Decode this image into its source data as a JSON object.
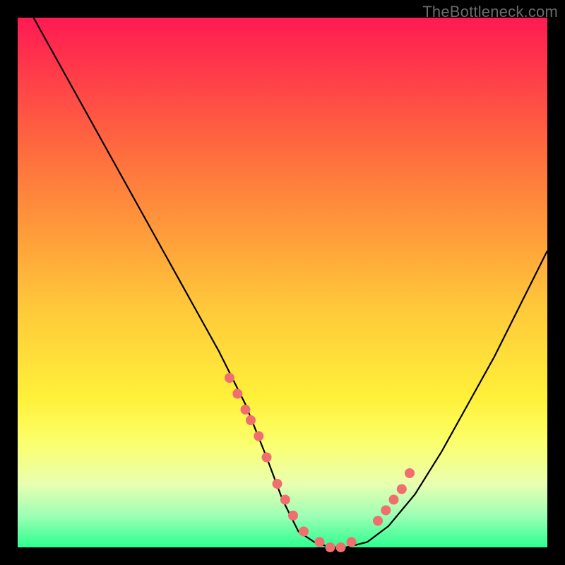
{
  "watermark": "TheBottleneck.com",
  "chart_data": {
    "type": "line",
    "title": "",
    "xlabel": "",
    "ylabel": "",
    "xlim": [
      0,
      100
    ],
    "ylim": [
      0,
      100
    ],
    "grid": false,
    "series": [
      {
        "name": "curve",
        "x": [
          3,
          8,
          13,
          18,
          23,
          28,
          33,
          38,
          43,
          47,
          50,
          53,
          56,
          59,
          62,
          66,
          70,
          75,
          80,
          85,
          90,
          95,
          100
        ],
        "y": [
          100,
          91,
          82,
          73,
          64,
          55,
          46,
          37,
          27,
          17,
          9,
          3,
          1,
          0,
          0,
          1,
          4,
          10,
          18,
          27,
          36,
          46,
          56
        ]
      }
    ],
    "markers": {
      "name": "highlight-dots",
      "color": "#f06e6e",
      "x": [
        40,
        41.5,
        43,
        44,
        45.5,
        47,
        49,
        50.5,
        52,
        54,
        57,
        59,
        61,
        63,
        68,
        69.5,
        71,
        72.5,
        74
      ],
      "y": [
        32,
        29,
        26,
        24,
        21,
        17,
        12,
        9,
        6,
        3,
        1,
        0,
        0,
        1,
        5,
        7,
        9,
        11,
        14
      ]
    }
  }
}
